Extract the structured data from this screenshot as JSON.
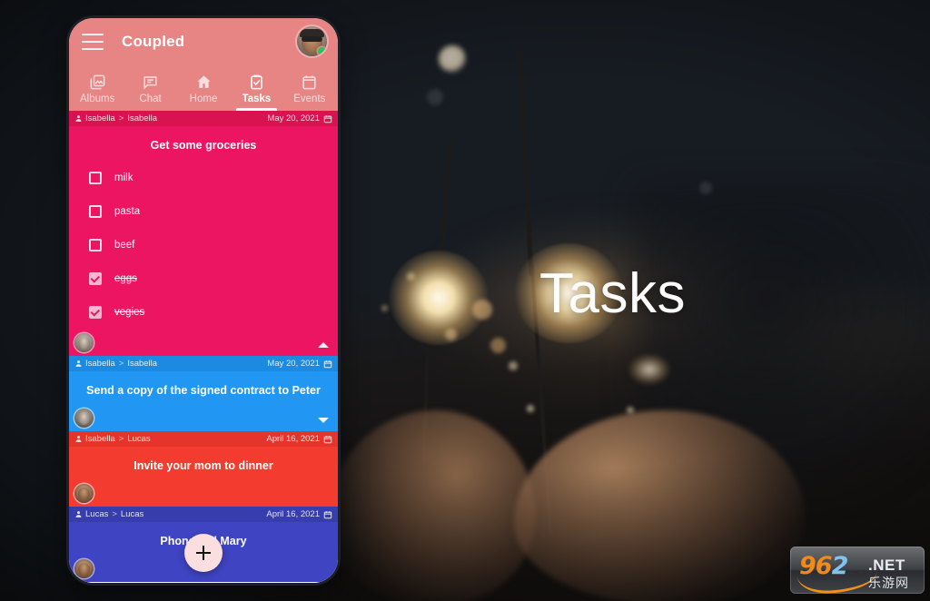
{
  "app": {
    "title": "Coupled",
    "menu_icon": "hamburger-menu-icon",
    "avatar_icon": "user-avatar",
    "online_status": "online"
  },
  "tabs": [
    {
      "label": "Albums",
      "icon": "photo-album-icon",
      "active": false
    },
    {
      "label": "Chat",
      "icon": "chat-bubble-icon",
      "active": false
    },
    {
      "label": "Home",
      "icon": "home-icon",
      "active": false
    },
    {
      "label": "Tasks",
      "icon": "clipboard-check-icon",
      "active": true
    },
    {
      "label": "Events",
      "icon": "calendar-icon",
      "active": false
    }
  ],
  "tasks": [
    {
      "from": "Isabella",
      "to": "Isabella",
      "date": "May 20, 2021",
      "title": "Get some groceries",
      "color": "#ec1561",
      "header_color": "#d9134f",
      "expanded": true,
      "chevron": "up",
      "items": [
        {
          "label": "milk",
          "done": false
        },
        {
          "label": "pasta",
          "done": false
        },
        {
          "label": "beef",
          "done": false
        },
        {
          "label": "eggs",
          "done": true
        },
        {
          "label": "vegies",
          "done": true
        }
      ]
    },
    {
      "from": "Isabella",
      "to": "Isabella",
      "date": "May 20, 2021",
      "title": "Send a copy of the signed contract to Peter",
      "color": "#2196f3",
      "header_color": "#1c8ae0",
      "expanded": false,
      "chevron": "down",
      "items": []
    },
    {
      "from": "Isabella",
      "to": "Lucas",
      "date": "April 16, 2021",
      "title": "Invite your mom to dinner",
      "color": "#f33b30",
      "header_color": "#e5352b",
      "expanded": false,
      "chevron": "none",
      "items": []
    },
    {
      "from": "Lucas",
      "to": "Lucas",
      "date": "April 16, 2021",
      "title": "Phone call Mary",
      "color": "#3f44c2",
      "header_color": "#383dae",
      "expanded": false,
      "chevron": "none",
      "items": []
    }
  ],
  "fab": {
    "label": "+",
    "icon": "plus-icon"
  },
  "hero": {
    "headline": "Tasks"
  },
  "watermark": {
    "num_96": "96",
    "num_2": "2",
    "net": ".NET",
    "cn": "乐游网"
  },
  "colors": {
    "appbar": "#e78484",
    "accent_pink": "#ec1561",
    "fab": "#fbdfe0",
    "online_green": "#22c55e"
  }
}
